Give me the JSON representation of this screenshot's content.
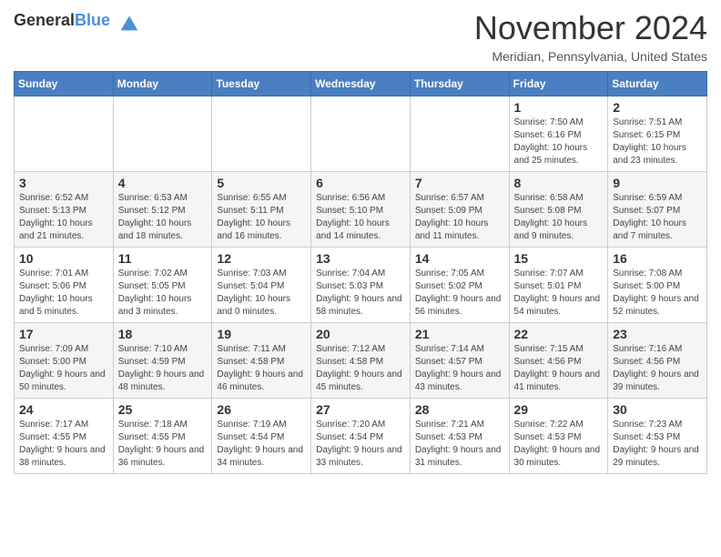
{
  "header": {
    "logo_general": "General",
    "logo_blue": "Blue",
    "month_title": "November 2024",
    "location": "Meridian, Pennsylvania, United States"
  },
  "days_of_week": [
    "Sunday",
    "Monday",
    "Tuesday",
    "Wednesday",
    "Thursday",
    "Friday",
    "Saturday"
  ],
  "weeks": [
    [
      {
        "day": "",
        "info": ""
      },
      {
        "day": "",
        "info": ""
      },
      {
        "day": "",
        "info": ""
      },
      {
        "day": "",
        "info": ""
      },
      {
        "day": "",
        "info": ""
      },
      {
        "day": "1",
        "info": "Sunrise: 7:50 AM\nSunset: 6:16 PM\nDaylight: 10 hours and 25 minutes."
      },
      {
        "day": "2",
        "info": "Sunrise: 7:51 AM\nSunset: 6:15 PM\nDaylight: 10 hours and 23 minutes."
      }
    ],
    [
      {
        "day": "3",
        "info": "Sunrise: 6:52 AM\nSunset: 5:13 PM\nDaylight: 10 hours and 21 minutes."
      },
      {
        "day": "4",
        "info": "Sunrise: 6:53 AM\nSunset: 5:12 PM\nDaylight: 10 hours and 18 minutes."
      },
      {
        "day": "5",
        "info": "Sunrise: 6:55 AM\nSunset: 5:11 PM\nDaylight: 10 hours and 16 minutes."
      },
      {
        "day": "6",
        "info": "Sunrise: 6:56 AM\nSunset: 5:10 PM\nDaylight: 10 hours and 14 minutes."
      },
      {
        "day": "7",
        "info": "Sunrise: 6:57 AM\nSunset: 5:09 PM\nDaylight: 10 hours and 11 minutes."
      },
      {
        "day": "8",
        "info": "Sunrise: 6:58 AM\nSunset: 5:08 PM\nDaylight: 10 hours and 9 minutes."
      },
      {
        "day": "9",
        "info": "Sunrise: 6:59 AM\nSunset: 5:07 PM\nDaylight: 10 hours and 7 minutes."
      }
    ],
    [
      {
        "day": "10",
        "info": "Sunrise: 7:01 AM\nSunset: 5:06 PM\nDaylight: 10 hours and 5 minutes."
      },
      {
        "day": "11",
        "info": "Sunrise: 7:02 AM\nSunset: 5:05 PM\nDaylight: 10 hours and 3 minutes."
      },
      {
        "day": "12",
        "info": "Sunrise: 7:03 AM\nSunset: 5:04 PM\nDaylight: 10 hours and 0 minutes."
      },
      {
        "day": "13",
        "info": "Sunrise: 7:04 AM\nSunset: 5:03 PM\nDaylight: 9 hours and 58 minutes."
      },
      {
        "day": "14",
        "info": "Sunrise: 7:05 AM\nSunset: 5:02 PM\nDaylight: 9 hours and 56 minutes."
      },
      {
        "day": "15",
        "info": "Sunrise: 7:07 AM\nSunset: 5:01 PM\nDaylight: 9 hours and 54 minutes."
      },
      {
        "day": "16",
        "info": "Sunrise: 7:08 AM\nSunset: 5:00 PM\nDaylight: 9 hours and 52 minutes."
      }
    ],
    [
      {
        "day": "17",
        "info": "Sunrise: 7:09 AM\nSunset: 5:00 PM\nDaylight: 9 hours and 50 minutes."
      },
      {
        "day": "18",
        "info": "Sunrise: 7:10 AM\nSunset: 4:59 PM\nDaylight: 9 hours and 48 minutes."
      },
      {
        "day": "19",
        "info": "Sunrise: 7:11 AM\nSunset: 4:58 PM\nDaylight: 9 hours and 46 minutes."
      },
      {
        "day": "20",
        "info": "Sunrise: 7:12 AM\nSunset: 4:58 PM\nDaylight: 9 hours and 45 minutes."
      },
      {
        "day": "21",
        "info": "Sunrise: 7:14 AM\nSunset: 4:57 PM\nDaylight: 9 hours and 43 minutes."
      },
      {
        "day": "22",
        "info": "Sunrise: 7:15 AM\nSunset: 4:56 PM\nDaylight: 9 hours and 41 minutes."
      },
      {
        "day": "23",
        "info": "Sunrise: 7:16 AM\nSunset: 4:56 PM\nDaylight: 9 hours and 39 minutes."
      }
    ],
    [
      {
        "day": "24",
        "info": "Sunrise: 7:17 AM\nSunset: 4:55 PM\nDaylight: 9 hours and 38 minutes."
      },
      {
        "day": "25",
        "info": "Sunrise: 7:18 AM\nSunset: 4:55 PM\nDaylight: 9 hours and 36 minutes."
      },
      {
        "day": "26",
        "info": "Sunrise: 7:19 AM\nSunset: 4:54 PM\nDaylight: 9 hours and 34 minutes."
      },
      {
        "day": "27",
        "info": "Sunrise: 7:20 AM\nSunset: 4:54 PM\nDaylight: 9 hours and 33 minutes."
      },
      {
        "day": "28",
        "info": "Sunrise: 7:21 AM\nSunset: 4:53 PM\nDaylight: 9 hours and 31 minutes."
      },
      {
        "day": "29",
        "info": "Sunrise: 7:22 AM\nSunset: 4:53 PM\nDaylight: 9 hours and 30 minutes."
      },
      {
        "day": "30",
        "info": "Sunrise: 7:23 AM\nSunset: 4:53 PM\nDaylight: 9 hours and 29 minutes."
      }
    ]
  ]
}
